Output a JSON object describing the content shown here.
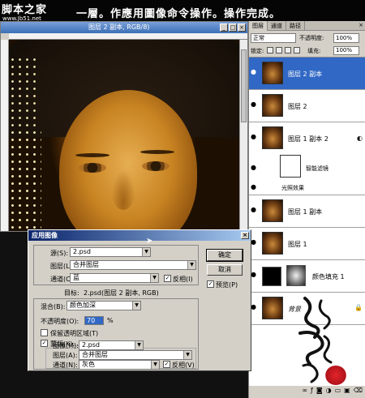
{
  "caption": {
    "site_logo": "脚本之家",
    "site_url": "www.Jb51.net",
    "instruction": "一層。作應用圖像命令操作。操作完成。"
  },
  "document": {
    "title": "图层 2 副本, RGB/8)",
    "minimize": "_",
    "maximize": "□",
    "close": "×"
  },
  "layers_panel": {
    "tabs": [
      "图层",
      "通道",
      "路径"
    ],
    "close": "×",
    "blend_mode": "正常",
    "opacity_label": "不透明度:",
    "opacity_value": "100%",
    "lock_label": "锁定:",
    "fill_label": "填充:",
    "fill_value": "100%",
    "layers": [
      {
        "name": "图层 2 副本",
        "selected": true
      },
      {
        "name": "图层 2",
        "selected": false
      },
      {
        "name": "图层 1 副本 2",
        "selected": false
      },
      {
        "name": "智能滤镜",
        "selected": false
      },
      {
        "name": "光照效果",
        "selected": false
      },
      {
        "name": "图层 1 副本",
        "selected": false
      },
      {
        "name": "图层 1",
        "selected": false
      },
      {
        "name": "颜色填充 1",
        "selected": false
      },
      {
        "name": "背景",
        "selected": false
      }
    ]
  },
  "dialog": {
    "title": "应用图像",
    "close": "×",
    "source_label": "源(S):",
    "source_value": "2.psd",
    "layer_label": "图层(L):",
    "layer_value": "合并图层",
    "channel_label": "通道(C):",
    "channel_value": "蓝",
    "invert_label": "反相(I)",
    "target_label": "目标:",
    "target_value": "2.psd(图层 2 副本, RGB)",
    "blending_label": "混合(B):",
    "blending_value": "颜色加深",
    "opacity_label": "不透明度(O):",
    "opacity_value": "70",
    "opacity_unit": "%",
    "preserve_label": "保留透明区域(T)",
    "mask_label": "蒙版(K)...",
    "image_label": "图像(M):",
    "image_value": "2.psd",
    "mask_layer_label": "图层(A):",
    "mask_layer_value": "合并图层",
    "mask_channel_label": "通道(N):",
    "mask_channel_value": "灰色",
    "mask_invert_label": "反相(V)",
    "ok": "确定",
    "cancel": "取消",
    "preview": "预览(P)",
    "check": "✓",
    "arrow": "▼"
  }
}
